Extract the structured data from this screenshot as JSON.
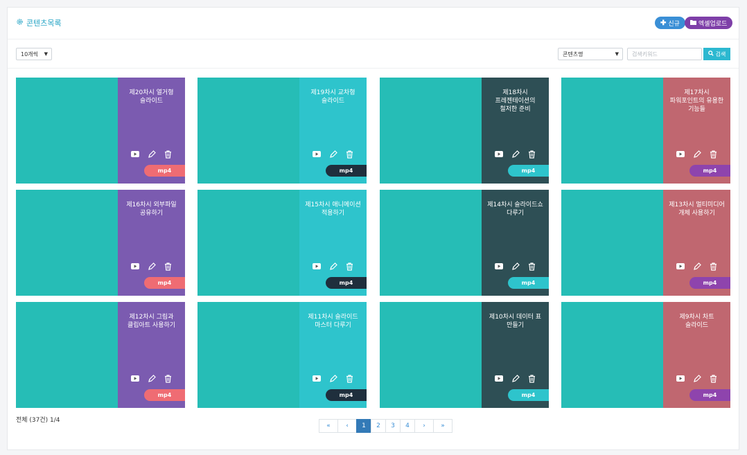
{
  "header": {
    "title": "콘텐츠목록",
    "new_label": "신규",
    "excel_label": "엑셀업로드"
  },
  "toolbar": {
    "page_size": "10개씩",
    "search_field": "콘텐츠명",
    "search_placeholder": "검색키워드",
    "search_label": "검색"
  },
  "colors": {
    "thumb": "#26bdb6",
    "purple": "#7b5bb0",
    "cyan": "#2ec4cc",
    "darkslate": "#2e4f55",
    "rose": "#c06770",
    "badge_coral": "#ef6c73",
    "badge_navy": "#1f2f3d",
    "badge_cyan": "#2ec4cc",
    "badge_violet": "#8e44ad"
  },
  "cards": [
    {
      "title": "제20차시 열거형 슬라이드",
      "badge": "mp4",
      "side": "purple",
      "badge_color": "badge_coral"
    },
    {
      "title": "제19차시 교차형 슬라이드",
      "badge": "mp4",
      "side": "cyan",
      "badge_color": "badge_navy"
    },
    {
      "title": "제18차시 프레젠테이션의 철저한 준비",
      "badge": "mp4",
      "side": "darkslate",
      "badge_color": "badge_cyan"
    },
    {
      "title": "제17차시 파워포인트의 유용한 기능들",
      "badge": "mp4",
      "side": "rose",
      "badge_color": "badge_violet"
    },
    {
      "title": "제16차시 외부파일 공유하기",
      "badge": "mp4",
      "side": "purple",
      "badge_color": "badge_coral"
    },
    {
      "title": "제15차시 애니메이션 적용하기",
      "badge": "mp4",
      "side": "cyan",
      "badge_color": "badge_navy"
    },
    {
      "title": "제14차시 슬라이드쇼 다루기",
      "badge": "mp4",
      "side": "darkslate",
      "badge_color": "badge_cyan"
    },
    {
      "title": "제13차시 멀티미디어 개체 사용하기",
      "badge": "mp4",
      "side": "rose",
      "badge_color": "badge_violet"
    },
    {
      "title": "제12차시 그림과 클립아트 사용하기",
      "badge": "mp4",
      "side": "purple",
      "badge_color": "badge_coral"
    },
    {
      "title": "제11차시 슬라이드 마스터 다루기",
      "badge": "mp4",
      "side": "cyan",
      "badge_color": "badge_navy"
    },
    {
      "title": "제10차시 데이터 표 만들기",
      "badge": "mp4",
      "side": "darkslate",
      "badge_color": "badge_cyan"
    },
    {
      "title": "제9차시 차트 슬라이드",
      "badge": "mp4",
      "side": "rose",
      "badge_color": "badge_violet"
    }
  ],
  "footer": {
    "total": "전체 (37건) 1/4"
  },
  "pagination": {
    "first": "«",
    "prev": "‹",
    "pages": [
      "1",
      "2",
      "3",
      "4"
    ],
    "next": "›",
    "last": "»",
    "current": "1"
  }
}
